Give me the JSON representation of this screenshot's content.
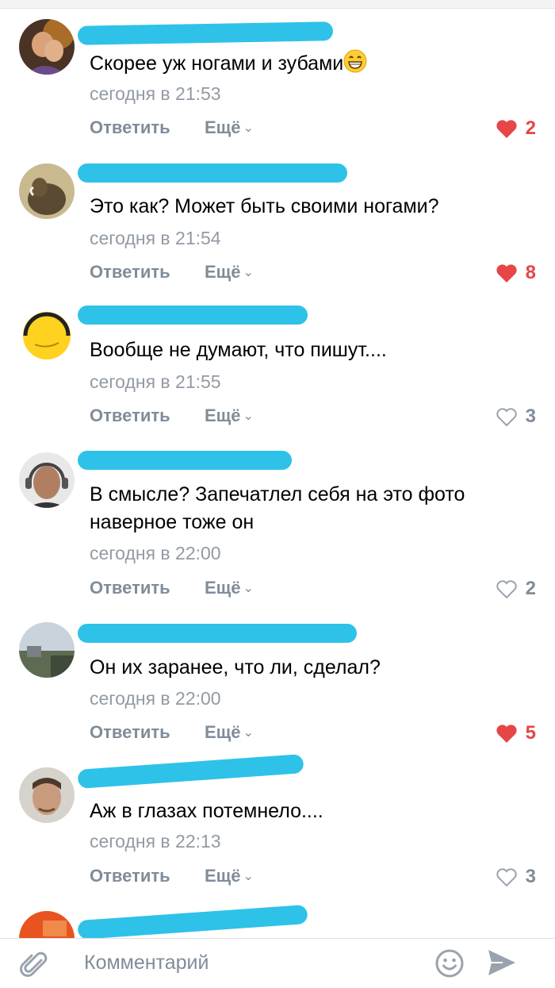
{
  "comments": [
    {
      "text": "Скорее уж ногами и зубами",
      "has_emoji": true,
      "emoji": "grinning-face-emoji",
      "time": "сегодня в 21:53",
      "reply": "Ответить",
      "more": "Ещё",
      "likes": "2",
      "liked": true
    },
    {
      "text": "Это как? Может быть своими ногами?",
      "time": "сегодня в 21:54",
      "reply": "Ответить",
      "more": "Ещё",
      "likes": "8",
      "liked": true
    },
    {
      "text": "Вообще не думают, что пишут....",
      "time": "сегодня в 21:55",
      "reply": "Ответить",
      "more": "Ещё",
      "likes": "3",
      "liked": false
    },
    {
      "text_line1": "В смысле? Запечатлел себя на это фото",
      "text_line2": "наверное тоже он",
      "time": "сегодня в 22:00",
      "reply": "Ответить",
      "more": "Ещё",
      "likes": "2",
      "liked": false
    },
    {
      "text": "Он их заранее, что ли, сделал?",
      "time": "сегодня в 22:00",
      "reply": "Ответить",
      "more": "Ещё",
      "likes": "5",
      "liked": true
    },
    {
      "text": "Аж в глазах потемнело....",
      "time": "сегодня в 22:13",
      "reply": "Ответить",
      "more": "Ещё",
      "likes": "3",
      "liked": false
    }
  ],
  "composer": {
    "placeholder": "Комментарий",
    "attach_icon": "paperclip-icon",
    "emoji_icon": "smile-icon",
    "send_icon": "send-icon"
  },
  "colors": {
    "redaction": "#2ec2e8",
    "like_active": "#e64646",
    "secondary_text": "#818c99"
  }
}
